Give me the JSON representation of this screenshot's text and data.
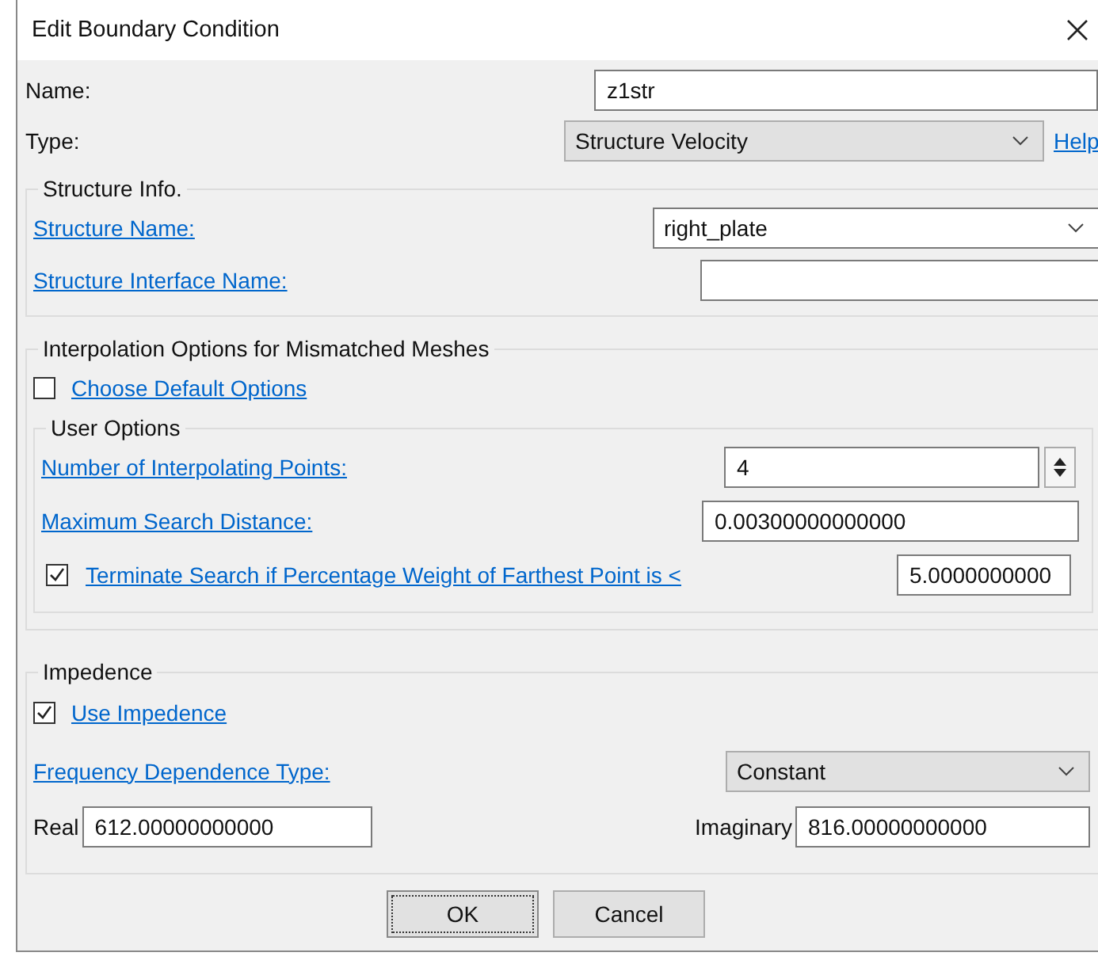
{
  "window": {
    "title": "Edit Boundary Condition"
  },
  "name": {
    "label": "Name:",
    "value": "z1str"
  },
  "type": {
    "label": "Type:",
    "value": "Structure Velocity",
    "help": "Help"
  },
  "structure_info": {
    "title": "Structure Info.",
    "structure_name": {
      "label": "Structure Name:",
      "value": "right_plate"
    },
    "interface_name": {
      "label": "Structure Interface Name:"
    }
  },
  "interpolation": {
    "title": "Interpolation Options for Mismatched Meshes",
    "default_options": {
      "label": "Choose Default Options",
      "checked": false
    },
    "user_options": {
      "title": "User Options",
      "points": {
        "label": "Number of Interpolating Points:",
        "value": "4"
      },
      "distance": {
        "label": "Maximum Search Distance:",
        "value": "0.00300000000000"
      },
      "terminate": {
        "label": "Terminate Search if Percentage Weight of Farthest Point is <",
        "checked": true,
        "value": "5.0000000000"
      }
    }
  },
  "impedence": {
    "title": "Impedence",
    "use": {
      "label": "Use Impedence",
      "checked": true
    },
    "frequency": {
      "label": "Frequency Dependence Type:",
      "value": "Constant"
    },
    "real": {
      "label": "Real",
      "value": "612.00000000000"
    },
    "imaginary": {
      "label": "Imaginary",
      "value": "816.00000000000"
    }
  },
  "buttons": [
    {
      "label": "OK",
      "default": true
    },
    {
      "label": "Cancel",
      "default": false
    }
  ]
}
